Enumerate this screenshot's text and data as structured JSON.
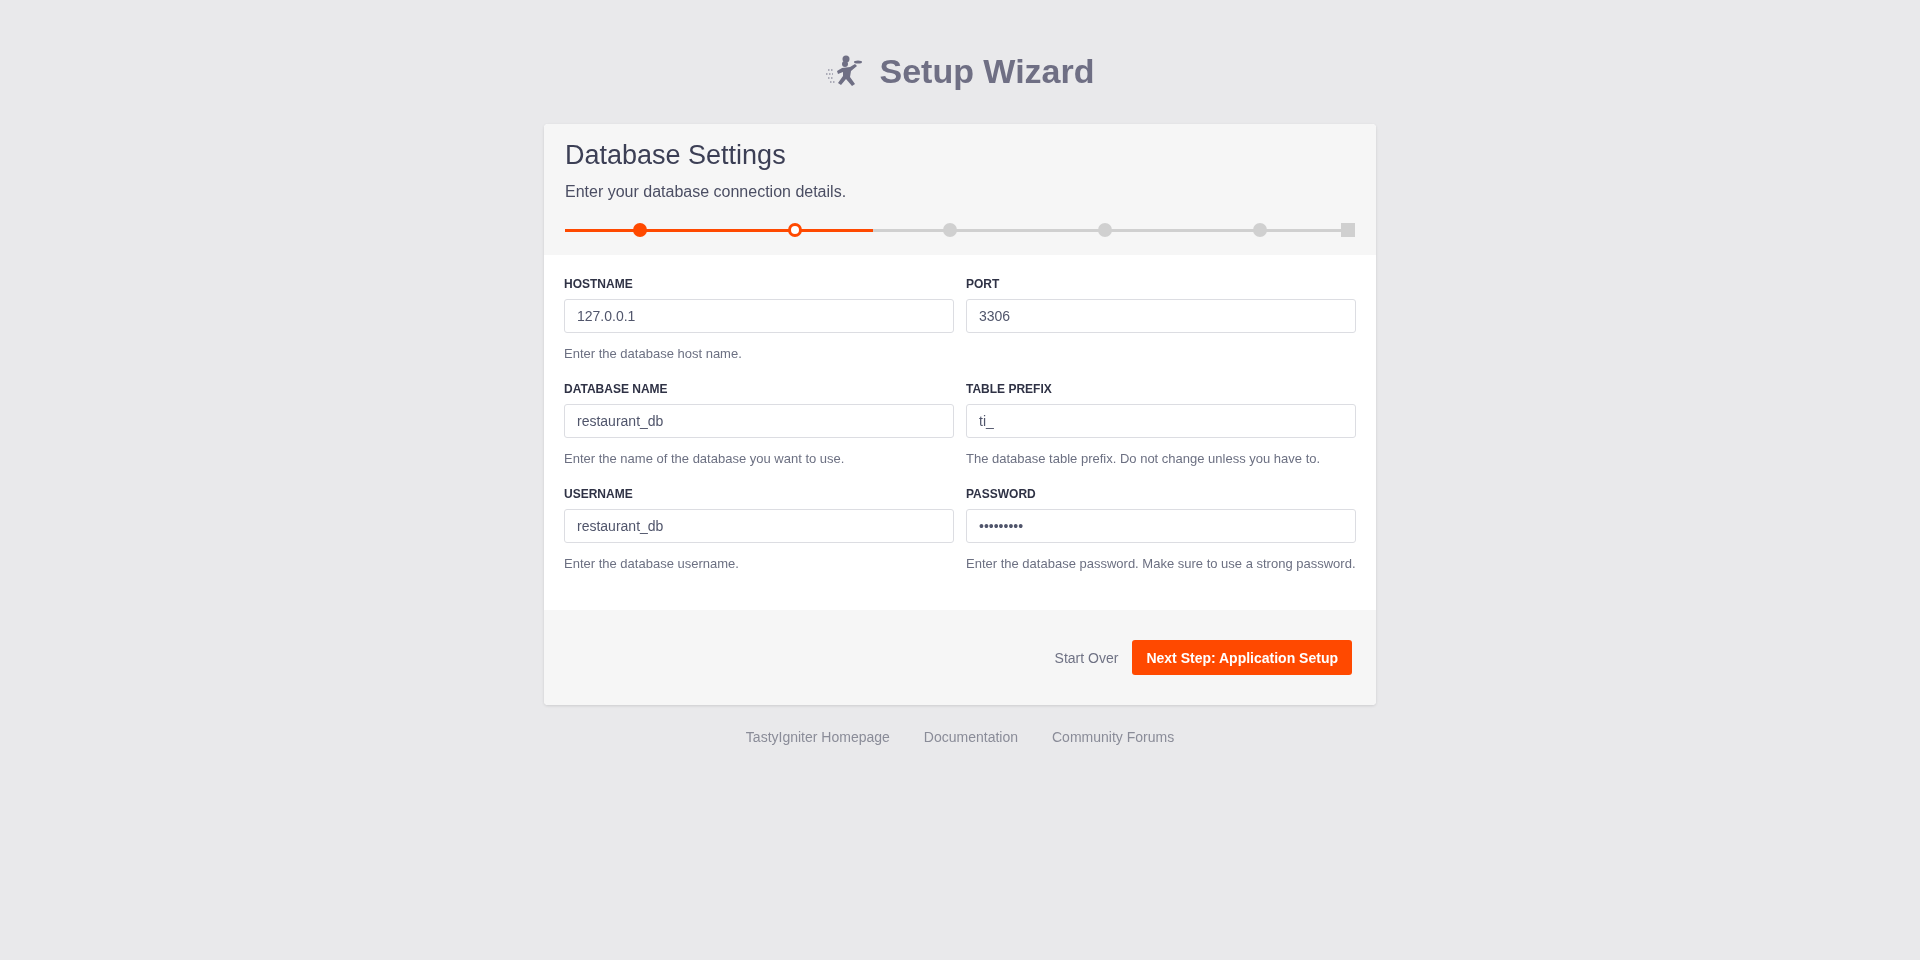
{
  "header": {
    "title": "Setup Wizard"
  },
  "card": {
    "title": "Database Settings",
    "subtitle": "Enter your database connection details.",
    "progress": {
      "level": 0.39,
      "steps": [
        {
          "kind": "dot",
          "completed": true,
          "selected": false
        },
        {
          "kind": "dot",
          "completed": false,
          "selected": true
        },
        {
          "kind": "dot",
          "completed": false,
          "selected": false
        },
        {
          "kind": "dot",
          "completed": false,
          "selected": false
        },
        {
          "kind": "dot",
          "completed": false,
          "selected": false
        },
        {
          "kind": "square",
          "completed": false,
          "selected": false
        }
      ]
    },
    "fields": [
      {
        "label": "HOSTNAME",
        "value": "127.0.0.1",
        "help": "Enter the database host name."
      },
      {
        "label": "PORT",
        "value": "3306"
      },
      {
        "label": "DATABASE NAME",
        "value": "restaurant_db",
        "help": "Enter the name of the database you want to use."
      },
      {
        "label": "TABLE PREFIX",
        "value": "ti_",
        "help": "The database table prefix. Do not change unless you have to."
      },
      {
        "label": "USERNAME",
        "value": "restaurant_db",
        "help": "Enter the database username."
      },
      {
        "label": "PASSWORD",
        "value": "•••••••••",
        "help": "Enter the database password. Make sure to use a strong password."
      }
    ],
    "actions": {
      "secondary": "Start Over",
      "primary": "Next Step: Application Setup"
    }
  },
  "footer_links": [
    "TastyIgniter Homepage",
    "Documentation",
    "Community Forums"
  ]
}
